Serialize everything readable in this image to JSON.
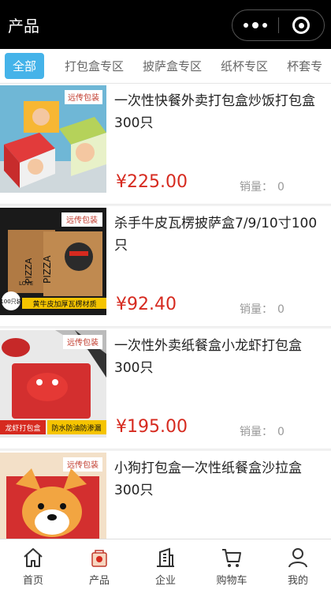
{
  "header": {
    "title": "产品"
  },
  "tabs": [
    {
      "label": "全部",
      "active": true
    },
    {
      "label": "打包盒专区"
    },
    {
      "label": "披萨盒专区"
    },
    {
      "label": "纸杯专区"
    },
    {
      "label": "杯套专"
    }
  ],
  "sales_label": "销量：",
  "products": [
    {
      "name": "一次性快餐外卖打包盒炒饭打包盒300只",
      "price": "¥225.00",
      "sales": "0",
      "brand": "远传包装"
    },
    {
      "name": "杀手牛皮瓦楞披萨盒7/9/10寸100只",
      "price": "¥92.40",
      "sales": "0",
      "brand": "远传包装",
      "img_text1": "PIZZA",
      "img_text2": "LOVE",
      "img_badge": "100只装",
      "img_caption": "黄牛皮加厚瓦楞材质"
    },
    {
      "name": "一次性外卖纸餐盒小龙虾打包盒300只",
      "price": "¥195.00",
      "sales": "0",
      "brand": "远传包装",
      "img_caption_left": "龙虾打包盒",
      "img_caption_right": "防水防油防渗漏"
    },
    {
      "name": "小狗打包盒一次性纸餐盒沙拉盒300只",
      "price": "",
      "sales": "",
      "brand": "远传包装"
    }
  ],
  "bottom_nav": [
    {
      "label": "首页",
      "icon": "home-icon"
    },
    {
      "label": "产品",
      "icon": "product-icon"
    },
    {
      "label": "企业",
      "icon": "building-icon"
    },
    {
      "label": "购物车",
      "icon": "cart-icon"
    },
    {
      "label": "我的",
      "icon": "user-icon"
    }
  ],
  "colors": {
    "accent": "#45b3e9",
    "price": "#d62a1f",
    "header_bg": "#000000"
  }
}
